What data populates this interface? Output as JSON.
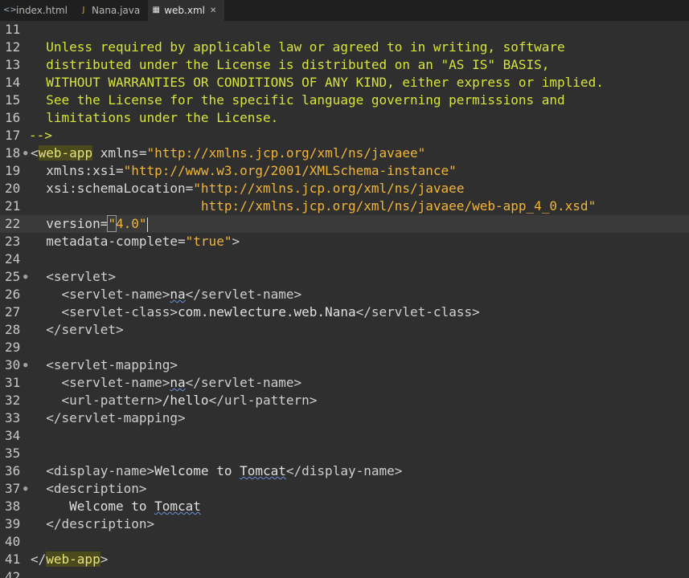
{
  "tabs": [
    {
      "icon": "html-file-icon",
      "label": "index.html",
      "active": false
    },
    {
      "icon": "java-file-icon",
      "label": "Nana.java",
      "active": false
    },
    {
      "icon": "xml-file-icon",
      "label": "web.xml",
      "active": true,
      "close": "✕"
    }
  ],
  "editor": {
    "current_line": 22,
    "lines": [
      {
        "n": "11"
      },
      {
        "n": "12",
        "t1": "  Unless required by applicable law or agreed to in writing, software"
      },
      {
        "n": "13",
        "t1": "  distributed under the License is distributed on an \"AS IS\" BASIS,"
      },
      {
        "n": "14",
        "t1": "  WITHOUT WARRANTIES OR CONDITIONS OF ANY KIND, either express or implied."
      },
      {
        "n": "15",
        "t1": "  See the License for the specific language governing permissions and"
      },
      {
        "n": "16",
        "t1": "  limitations under the License."
      },
      {
        "n": "17",
        "t1": "-->"
      },
      {
        "n": "18",
        "t1": "<",
        "t2": "web-app",
        "t3": " xmlns=",
        "t4": "\"http://xmlns.jcp.org/xml/ns/javaee\""
      },
      {
        "n": "19",
        "t1": "  xmlns:xsi=",
        "t2": "\"http://www.w3.org/2001/XMLSchema-instance\""
      },
      {
        "n": "20",
        "t1": "  xsi:schemaLocation=",
        "t2": "\"http://xmlns.jcp.org/xml/ns/javaee"
      },
      {
        "n": "21",
        "t1": "                      http://xmlns.jcp.org/xml/ns/javaee/web-app_4_0.xsd\""
      },
      {
        "n": "22",
        "t1": "  version=",
        "t2": "\"",
        "t3": "4.0\""
      },
      {
        "n": "23",
        "t1": "  metadata-complete=",
        "t2": "\"true\"",
        "t3": ">"
      },
      {
        "n": "24"
      },
      {
        "n": "25",
        "t1": "  <servlet>"
      },
      {
        "n": "26",
        "t1": "    <servlet-name>",
        "t2": "na",
        "t3": "</servlet-name>"
      },
      {
        "n": "27",
        "t1": "    <servlet-class>",
        "t2": "com.newlecture.web.Nana",
        "t3": "</servlet-class>"
      },
      {
        "n": "28",
        "t1": "  </servlet>"
      },
      {
        "n": "29"
      },
      {
        "n": "30",
        "t1": "  <servlet-mapping>"
      },
      {
        "n": "31",
        "t1": "    <servlet-name>",
        "t2": "na",
        "t3": "</servlet-name>"
      },
      {
        "n": "32",
        "t1": "    <url-pattern>",
        "t2": "/hello",
        "t3": "</url-pattern>"
      },
      {
        "n": "33",
        "t1": "  </servlet-mapping>"
      },
      {
        "n": "34"
      },
      {
        "n": "35"
      },
      {
        "n": "36",
        "t1": "  <display-name>",
        "t2": "Welcome to ",
        "t3": "Tomcat",
        "t4": "</display-name>"
      },
      {
        "n": "37",
        "t1": "  <description>"
      },
      {
        "n": "38",
        "t1": "     Welcome to ",
        "t2": "Tomcat"
      },
      {
        "n": "39",
        "t1": "  </description>"
      },
      {
        "n": "40"
      },
      {
        "n": "41",
        "t1": "</",
        "t2": "web-app",
        "t3": ">"
      },
      {
        "n": "42"
      }
    ]
  }
}
